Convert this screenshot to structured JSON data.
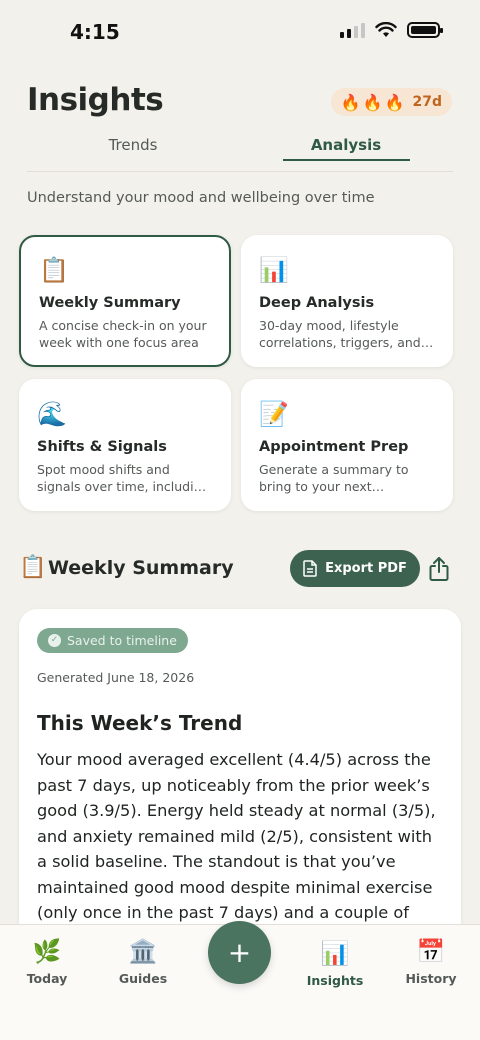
{
  "status_bar": {
    "time": "4:15"
  },
  "header": {
    "title": "Insights",
    "streak": {
      "flames": [
        "🔥",
        "🔥",
        "🔥"
      ],
      "count": "27d"
    }
  },
  "tabs": [
    {
      "label": "Trends",
      "active": false
    },
    {
      "label": "Analysis",
      "active": true
    }
  ],
  "subtitle": "Understand your mood and wellbeing over time",
  "cards": [
    {
      "icon": "📋",
      "title": "Weekly Summary",
      "description": "A concise check-in on your week with one focus area",
      "selected": true
    },
    {
      "icon": "📊",
      "title": "Deep Analysis",
      "description": "30-day mood, lifestyle correlations, triggers, and r...",
      "selected": false
    },
    {
      "icon": "🌊",
      "title": "Shifts & Signals",
      "description": "Spot mood shifts and signals over time, including medica...",
      "selected": false
    },
    {
      "icon": "📝",
      "title": "Appointment Prep",
      "description": "Generate a summary to bring to your next appointment",
      "selected": false
    }
  ],
  "section": {
    "icon": "📋",
    "title": "Weekly Summary",
    "export_label": "Export PDF"
  },
  "report": {
    "badge": "Saved to timeline",
    "generated": "Generated June 18, 2026",
    "heading": "This Week’s Trend",
    "body": "Your mood averaged excellent (4.4/5) across the past 7 days, up noticeably from the prior week’s good (3.9/5). Energy held steady at normal (3/5), and anxiety remained mild (2/5), consistent with a solid baseline. The standout is that you’ve maintained good mood despite minimal exercise (only once in the past 7 days) and a couple of nights"
  },
  "tabbar": {
    "items": [
      {
        "label": "Today",
        "icon": "🌿"
      },
      {
        "label": "Guides",
        "icon": "🏛️"
      },
      {
        "label": "Insights",
        "icon": "📊",
        "active": true
      },
      {
        "label": "History",
        "icon": "📅"
      }
    ],
    "fab": "+"
  },
  "colors": {
    "accent": "#2f5a45",
    "button": "#3d6250",
    "background": "#f3f1ec",
    "badge": "#7ea88f"
  }
}
